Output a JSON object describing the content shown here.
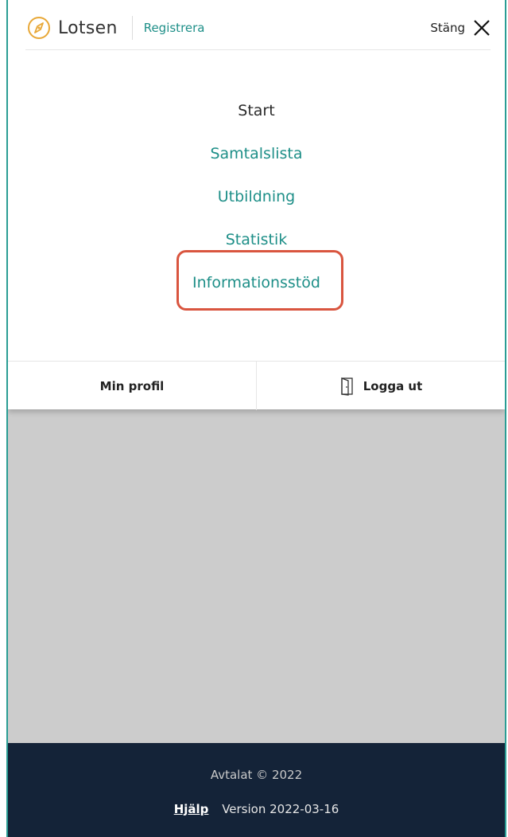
{
  "header": {
    "brand": "Lotsen",
    "register_label": "Registrera",
    "close_label": "Stäng"
  },
  "nav": {
    "items": [
      {
        "label": "Start",
        "active": true
      },
      {
        "label": "Samtalslista",
        "active": false
      },
      {
        "label": "Utbildning",
        "active": false
      },
      {
        "label": "Statistik",
        "active": false
      },
      {
        "label": "Informationsstöd",
        "active": false,
        "highlighted": true
      }
    ]
  },
  "actions": {
    "profile_label": "Min profil",
    "logout_label": "Logga ut"
  },
  "footer": {
    "copyright": "Avtalat © 2022",
    "help_label": "Hjälp",
    "version": "Version 2022-03-16"
  },
  "colors": {
    "accent": "#1e8f88",
    "highlight": "#d9553f",
    "footer_bg": "#142338",
    "overlay": "#cccccc"
  },
  "icons": {
    "logo": "compass-icon",
    "close": "close-icon",
    "logout": "door-icon"
  }
}
